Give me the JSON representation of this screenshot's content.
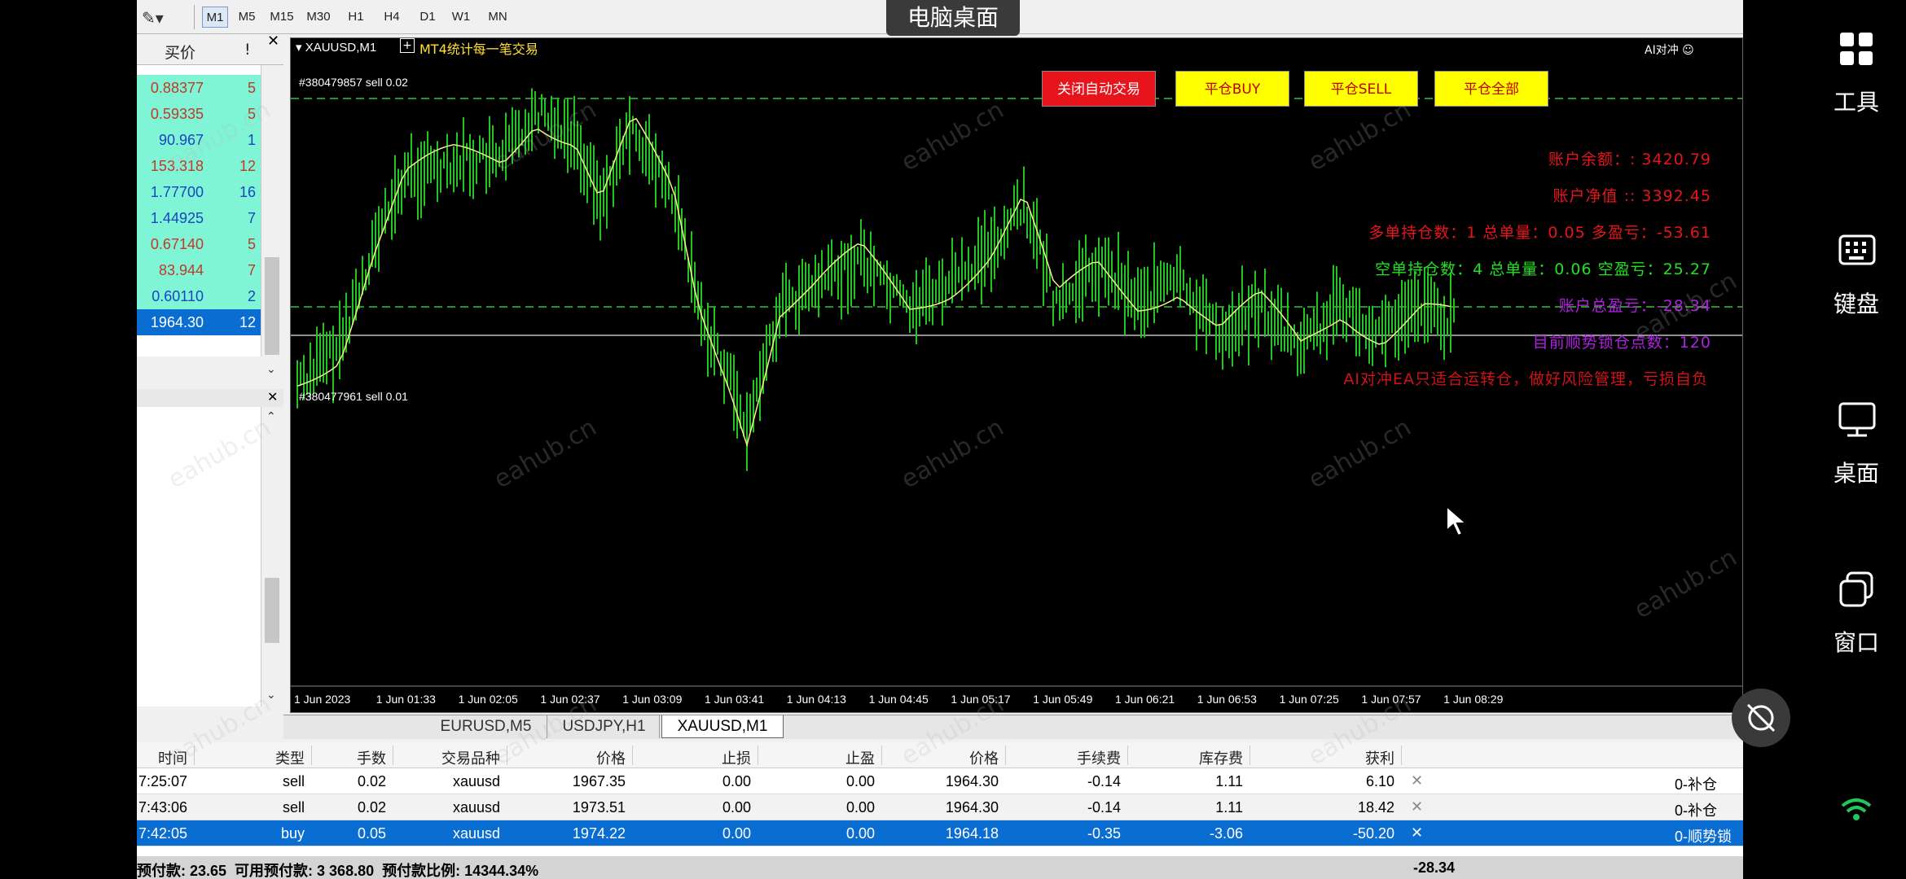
{
  "remote_title": "电脑桌面",
  "toolbar": {
    "timeframes": [
      "M1",
      "M5",
      "M15",
      "M30",
      "H1",
      "H4",
      "D1",
      "W1",
      "MN"
    ],
    "active": "M1"
  },
  "market_watch": {
    "header_bid": "买价",
    "header_spread": "!",
    "rows": [
      {
        "price": "0.88377",
        "spread": "5",
        "color": "#c0392b",
        "bg": "#7ff5d5"
      },
      {
        "price": "0.59335",
        "spread": "5",
        "color": "#c0392b",
        "bg": "#7ff5d5"
      },
      {
        "price": "90.967",
        "spread": "1",
        "color": "#1a44c0",
        "bg": "#7ff5d5"
      },
      {
        "price": "153.318",
        "spread": "12",
        "color": "#c0392b",
        "bg": "#7ff5d5"
      },
      {
        "price": "1.77700",
        "spread": "16",
        "color": "#1a44c0",
        "bg": "#7ff5d5"
      },
      {
        "price": "1.44925",
        "spread": "7",
        "color": "#1a44c0",
        "bg": "#7ff5d5"
      },
      {
        "price": "0.67140",
        "spread": "5",
        "color": "#c0392b",
        "bg": "#7ff5d5"
      },
      {
        "price": "83.944",
        "spread": "7",
        "color": "#c0392b",
        "bg": "#7ff5d5"
      },
      {
        "price": "0.60110",
        "spread": "2",
        "color": "#1a44c0",
        "bg": "#7ff5d5"
      },
      {
        "price": "1964.30",
        "spread": "12",
        "color": "#ffffff",
        "bg": "#0a6dd1"
      }
    ]
  },
  "chart": {
    "symbol": "XAUUSD,M1",
    "ea_name": "MT4统计每一笔交易",
    "ai_label": "AI对冲",
    "order_line_1": "#380479857 sell 0.02",
    "order_line_2": "#380477961 sell 0.01",
    "buttons": [
      {
        "label": "关闭自动交易",
        "bg": "#e8141b",
        "color": "#ffffff"
      },
      {
        "label": "平仓BUY",
        "bg": "#ffff00",
        "color": "#c00000"
      },
      {
        "label": "平仓SELL",
        "bg": "#ffff00",
        "color": "#c00000"
      },
      {
        "label": "平仓全部",
        "bg": "#ffff00",
        "color": "#c00000"
      }
    ],
    "info": [
      {
        "text": "账户余额：: 3420.79",
        "color": "#e8141b"
      },
      {
        "text": "账户净值 :: 3392.45",
        "color": "#e8141b"
      },
      {
        "text": "多单持仓数：1 总单量：0.05 多盈亏：-53.61",
        "color": "#e8141b"
      },
      {
        "text": "空单持仓数：4 总单量：0.06 空盈亏：25.27",
        "color": "#22e022"
      },
      {
        "text": "账户总盈亏：-28.34",
        "color": "#b020e0"
      },
      {
        "text": "目前顺势锁仓点数：120",
        "color": "#b020e0"
      },
      {
        "text": "AI对冲EA只适合运转仓，做好风险管理，亏损自负",
        "color": "#e8141b"
      }
    ],
    "time_labels": [
      "1 Jun 2023",
      "1 Jun 01:33",
      "1 Jun 02:05",
      "1 Jun 02:37",
      "1 Jun 03:09",
      "1 Jun 03:41",
      "1 Jun 04:13",
      "1 Jun 04:45",
      "1 Jun 05:17",
      "1 Jun 05:49",
      "1 Jun 06:21",
      "1 Jun 06:53",
      "1 Jun 07:25",
      "1 Jun 07:57",
      "1 Jun 08:29"
    ]
  },
  "chart_tabs": [
    "EURUSD,M5",
    "USDJPY,H1",
    "XAUUSD,M1"
  ],
  "active_chart_tab": "XAUUSD,M1",
  "trade": {
    "headers": [
      "时间",
      "类型",
      "手数",
      "交易品种",
      "价格",
      "止损",
      "止盈",
      "价格",
      "手续费",
      "库存费",
      "获利"
    ],
    "rows": [
      {
        "time": "7:25:07",
        "type": "sell",
        "lots": "0.02",
        "symbol": "xauusd",
        "price": "1967.35",
        "sl": "0.00",
        "tp": "0.00",
        "cur": "1964.30",
        "commission": "-0.14",
        "swap": "1.11",
        "profit": "6.10",
        "comment": "0-补仓",
        "selected": false
      },
      {
        "time": "7:43:06",
        "type": "sell",
        "lots": "0.02",
        "symbol": "xauusd",
        "price": "1973.51",
        "sl": "0.00",
        "tp": "0.00",
        "cur": "1964.30",
        "commission": "-0.14",
        "swap": "1.11",
        "profit": "18.42",
        "comment": "0-补仓",
        "selected": false
      },
      {
        "time": "7:42:05",
        "type": "buy",
        "lots": "0.05",
        "symbol": "xauusd",
        "price": "1974.22",
        "sl": "0.00",
        "tp": "0.00",
        "cur": "1964.18",
        "commission": "-0.35",
        "swap": "-3.06",
        "profit": "-50.20",
        "comment": "0-顺势锁",
        "selected": true
      }
    ],
    "summary": "预付款: 23.65  可用预付款: 3 368.80  预付款比例: 14344.34%",
    "summary_total": "-28.34"
  },
  "right_panel": {
    "tools": "工具",
    "keyboard": "键盘",
    "desktop": "桌面",
    "window": "窗口"
  },
  "watermark": "eahub.cn"
}
